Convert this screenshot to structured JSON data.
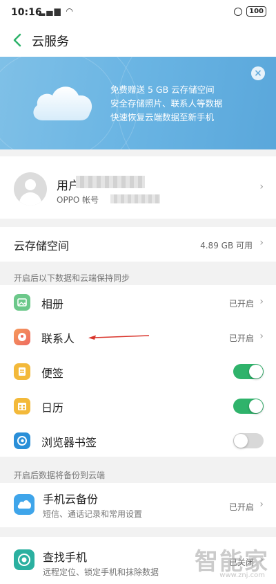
{
  "statusbar": {
    "time": "10:16",
    "battery": "100"
  },
  "header": {
    "title": "云服务"
  },
  "banner": {
    "lines": [
      "免费赠送 5 GB 云存储空间",
      "安全存储照片、联系人等数据",
      "快速恢复云端数据至新手机"
    ]
  },
  "account": {
    "name_prefix": "用户",
    "id_prefix": "OPPO 帐号"
  },
  "storage": {
    "label": "云存储空间",
    "value": "4.89 GB 可用"
  },
  "sync_section": {
    "label": "开启后以下数据和云端保持同步",
    "items": [
      {
        "label": "相册",
        "status": "已开启",
        "icon": "photo-icon",
        "color": "#6cc88a"
      },
      {
        "label": "联系人",
        "status": "已开启",
        "icon": "contacts-icon",
        "color": "#f07a5a"
      },
      {
        "label": "便签",
        "toggle": true,
        "icon": "notes-icon",
        "color": "#f3b93a"
      },
      {
        "label": "日历",
        "toggle": true,
        "icon": "calendar-icon",
        "color": "#f3b93a"
      },
      {
        "label": "浏览器书签",
        "toggle": false,
        "icon": "browser-icon",
        "color": "#2a8fd8"
      }
    ]
  },
  "backup_section": {
    "label": "开启后数据将备份到云端",
    "backup": {
      "label": "手机云备份",
      "sub": "短信、通话记录和常用设置",
      "status": "已开启"
    }
  },
  "find_phone": {
    "label": "查找手机",
    "sub": "远程定位、锁定手机和抹除数据",
    "status": "已关闭"
  },
  "watermark": {
    "text": "智能家",
    "url": "www.znj.com"
  },
  "colors": {
    "toggle_on": "#2fb36b",
    "toggle_off": "#d8d8d8",
    "back_arrow": "#2fb36b",
    "banner": "#69b4e3"
  }
}
